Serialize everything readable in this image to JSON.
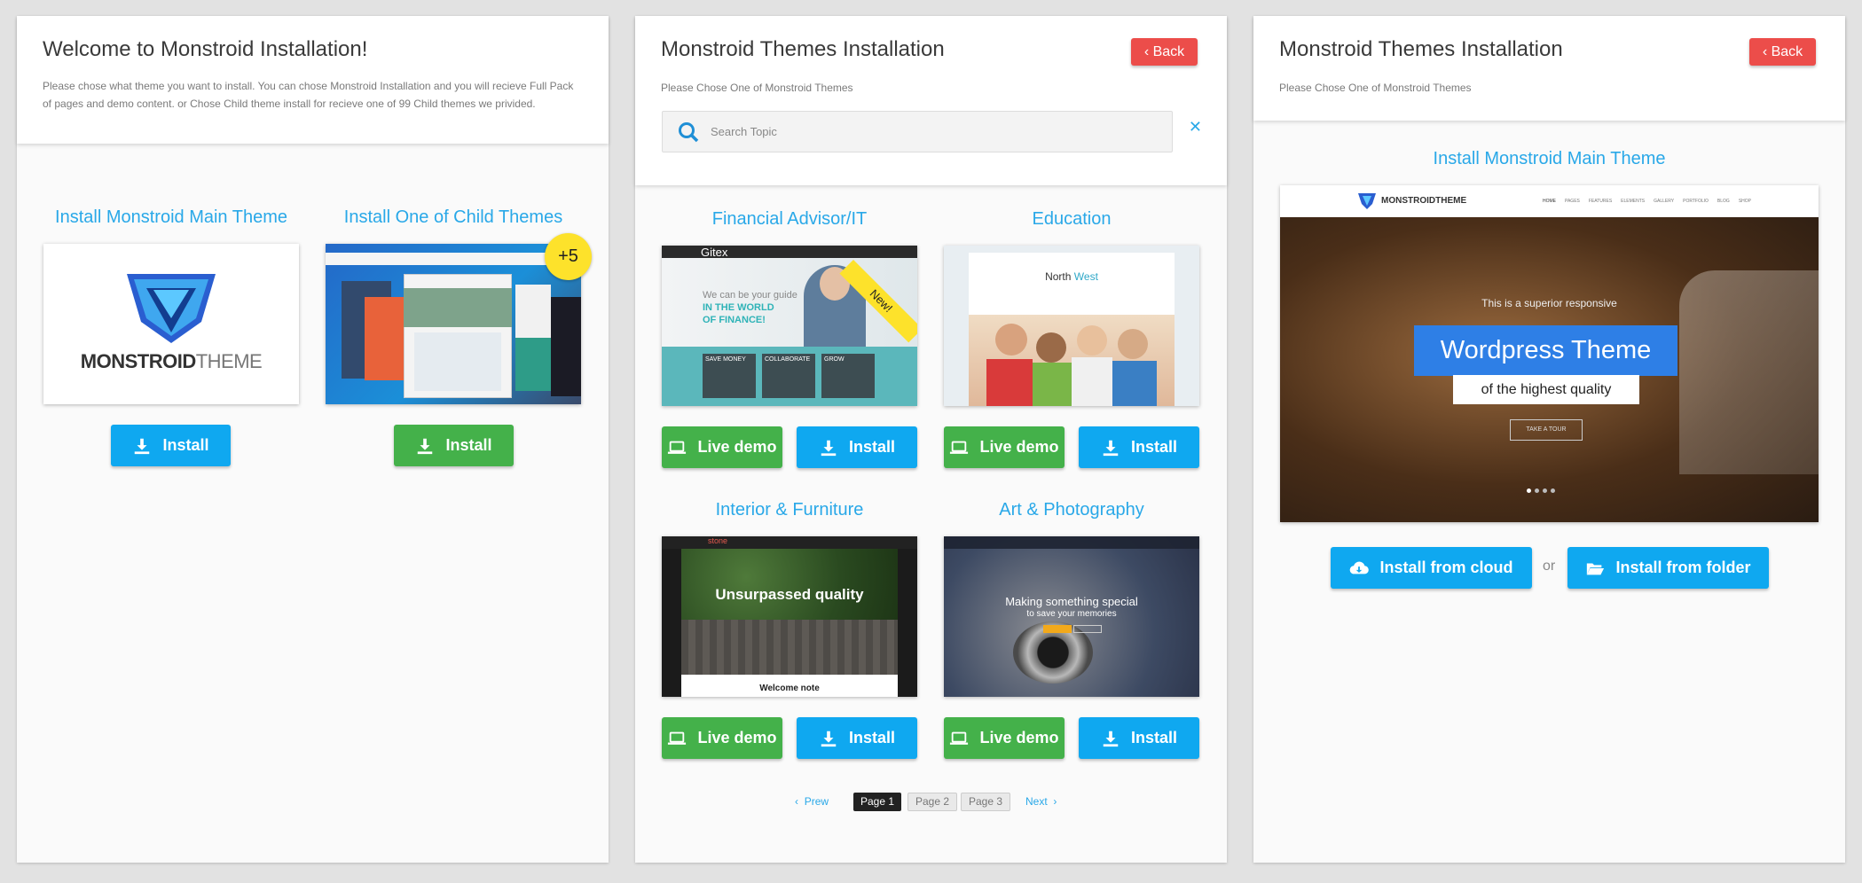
{
  "panel1": {
    "title": "Welcome to Monstroid Installation!",
    "description": "Please chose what theme you want to install. You can chose Monstroid Installation and you will recieve Full Pack of pages and demo content. or Chose Child theme install for recieve one of 99 Child themes we privided.",
    "main_title": "Install Monstroid Main Theme",
    "child_title": "Install One of Child Themes",
    "logo_bold": "MONSTROID",
    "logo_light": "THEME",
    "badge": "+5",
    "install_label": "Install"
  },
  "panel2": {
    "title": "Monstroid Themes Installation",
    "subtitle": "Please Chose One of Monstroid Themes",
    "back_label": "Back",
    "search_placeholder": "Search Topic",
    "live_demo_label": "Live demo",
    "install_label": "Install",
    "themes": [
      {
        "name": "Financial Advisor/IT",
        "ribbon": "New!",
        "thumb_text": [
          "Gitex",
          "We can be your guide",
          "IN THE WORLD",
          "OF FINANCE!",
          "SAVE MONEY",
          "COLLABORATE",
          "GROW"
        ]
      },
      {
        "name": "Education",
        "thumb_text": [
          "North",
          "West"
        ]
      },
      {
        "name": "Interior & Furniture",
        "thumb_text": [
          "stone",
          "Unsurpassed quality",
          "Welcome note"
        ]
      },
      {
        "name": "Art & Photography",
        "thumb_text": [
          "Making something special",
          "to save your memories"
        ]
      }
    ],
    "pagination": {
      "prev": "Prew",
      "pages": [
        "Page 1",
        "Page 2",
        "Page 3"
      ],
      "active_page": "Page 1",
      "next": "Next"
    }
  },
  "panel3": {
    "title": "Monstroid Themes Installation",
    "subtitle": "Please Chose One of Monstroid Themes",
    "back_label": "Back",
    "main_title": "Install Monstroid Main Theme",
    "preview": {
      "brand": "MONSTROIDTHEME",
      "nav": [
        "HOME",
        "PAGES",
        "FEATURES",
        "ELEMENTS",
        "GALLERY",
        "PORTFOLIO",
        "BLOG",
        "SHOP"
      ],
      "kicker": "This is a superior responsive",
      "headline": "Wordpress Theme",
      "tagline": "of the highest quality",
      "cta": "TAKE A TOUR"
    },
    "install_cloud_label": "Install from cloud",
    "or_label": "or",
    "install_folder_label": "Install from folder"
  },
  "colors": {
    "accent_blue": "#0fa8f0",
    "title_blue": "#29a8e8",
    "green": "#44b14a",
    "back_red": "#ec4d4a",
    "badge_yellow": "#fde22b"
  }
}
